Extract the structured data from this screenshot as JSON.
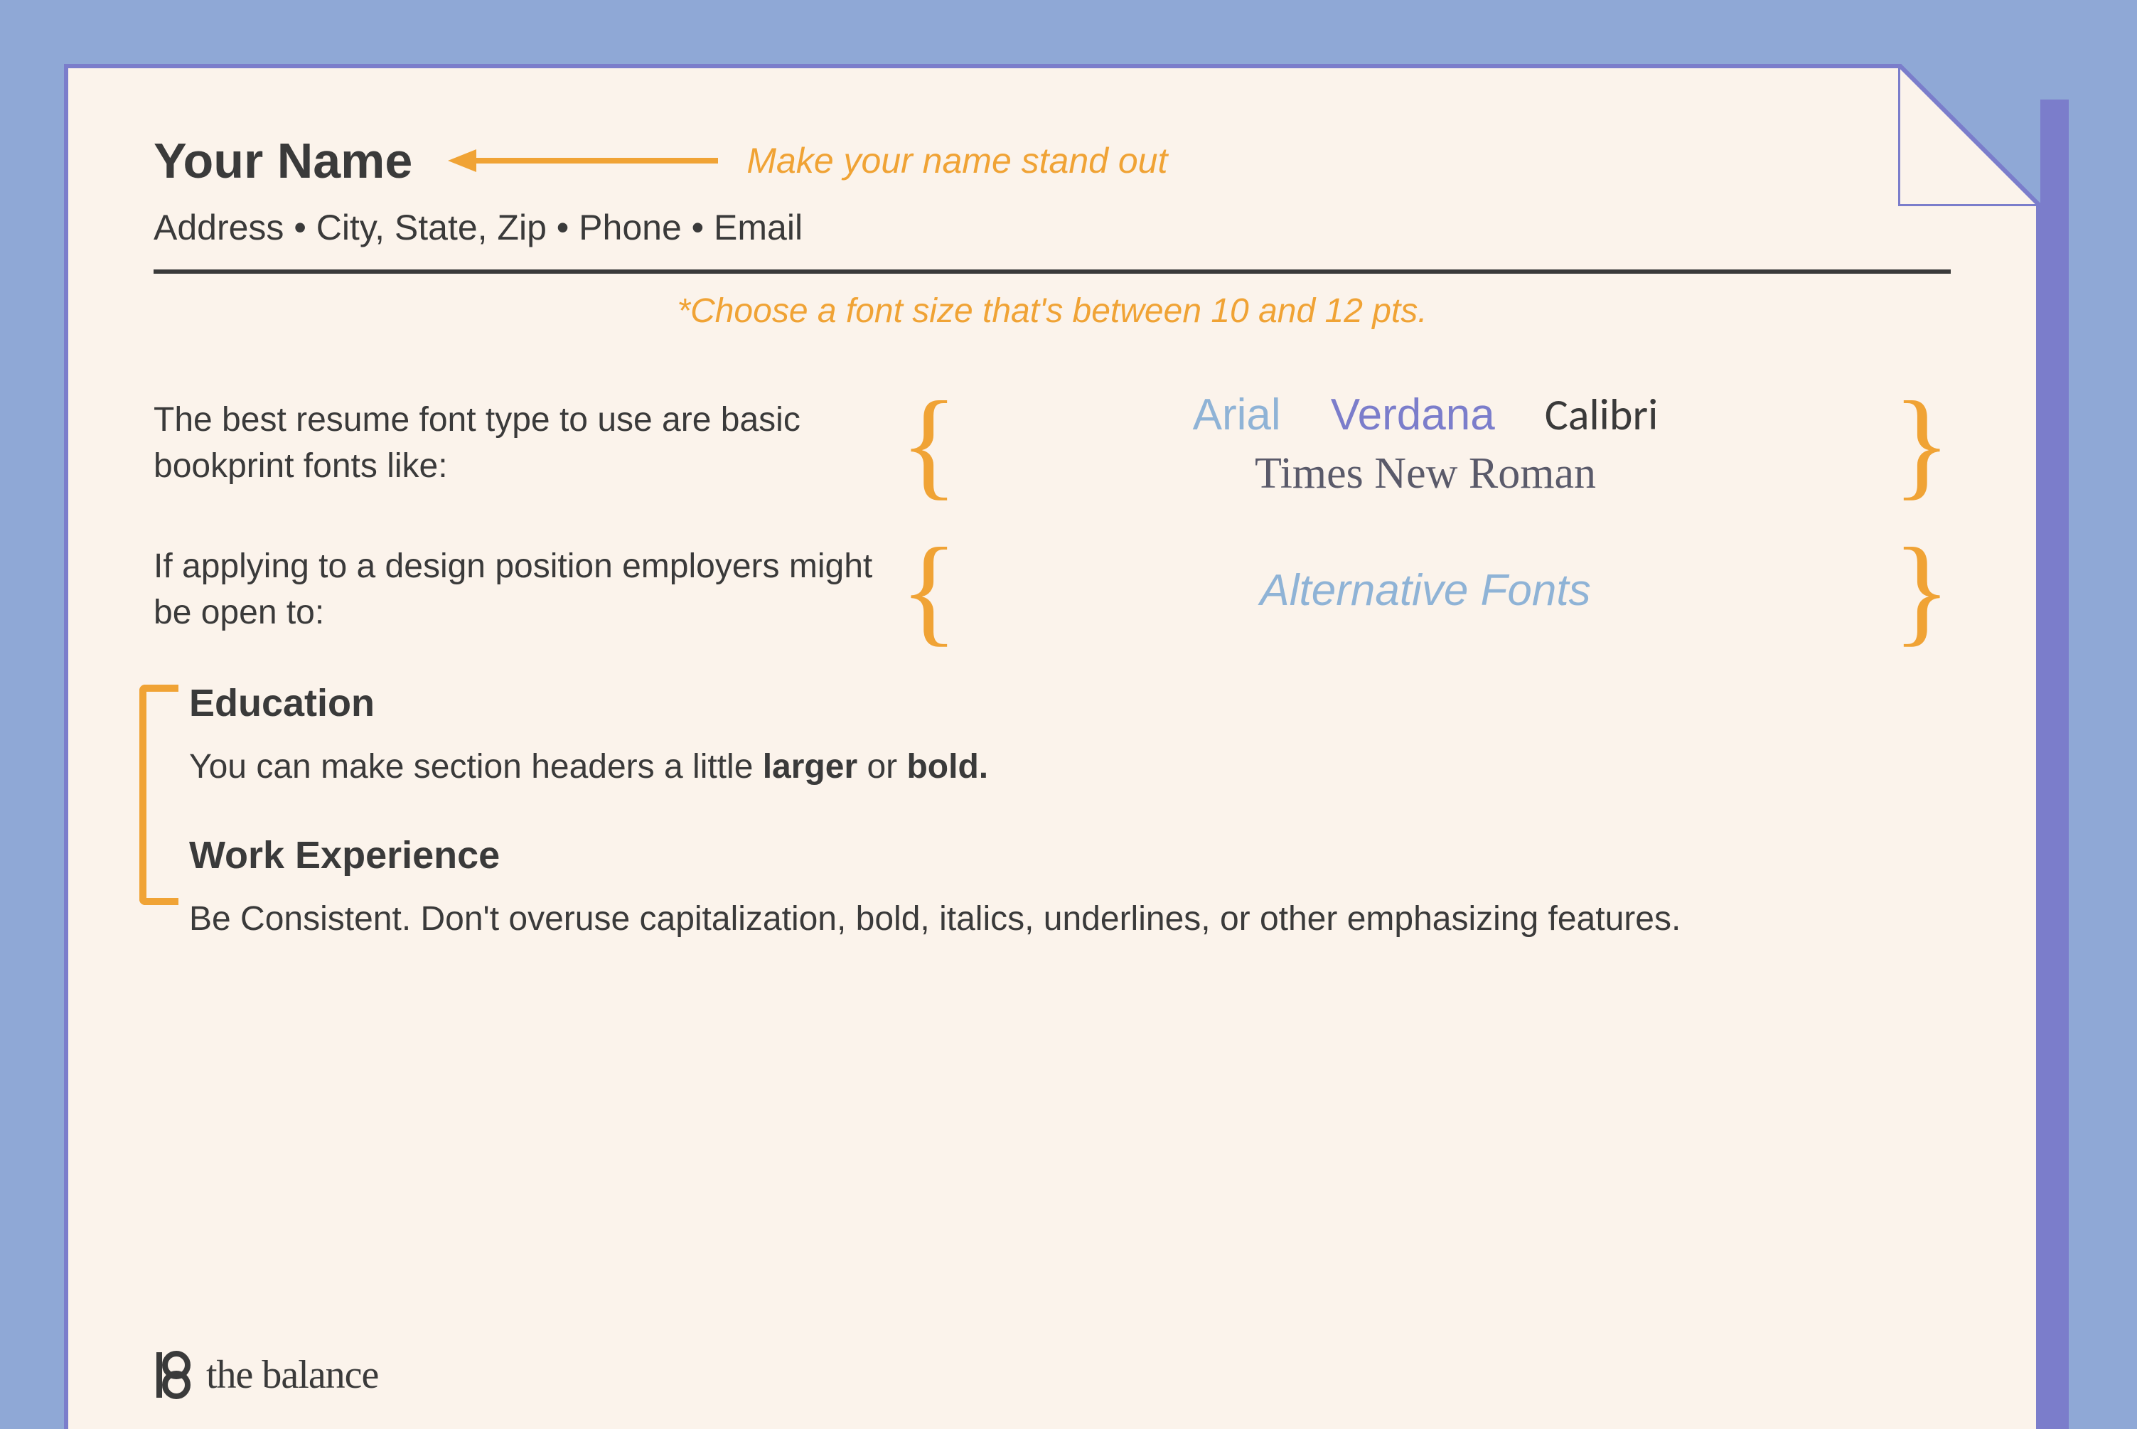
{
  "header": {
    "name": "Your Name",
    "name_callout": "Make your name stand out",
    "contact_line": "Address • City, State, Zip • Phone • Email"
  },
  "tips": {
    "font_size": "*Choose a font size that's between 10 and 12 pts.",
    "basic_fonts_intro": "The best resume font type to use are basic bookprint fonts like:",
    "design_fonts_intro": "If applying to a design position employers might be open to:"
  },
  "font_examples": {
    "arial": "Arial",
    "verdana": "Verdana",
    "calibri": "Calibri",
    "times": "Times New Roman",
    "alternative": "Alternative Fonts"
  },
  "sections": {
    "education_title": "Education",
    "education_body_pre": "You can make section headers a little ",
    "education_body_b1": "larger",
    "education_body_mid": " or ",
    "education_body_b2": "bold.",
    "work_title": "Work Experience",
    "work_body": "Be Consistent. Don't overuse capitalization, bold, italics, underlines, or other emphasizing features."
  },
  "brand": {
    "name": "the balance"
  }
}
